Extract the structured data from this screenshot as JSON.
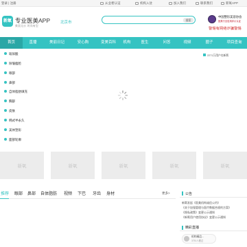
{
  "topbar": {
    "login": "登录 | 注册",
    "items": [
      "从业者认证",
      "机构入驻",
      "加入我们",
      "联系我们",
      "新氧APP"
    ]
  },
  "header": {
    "logo_badge": "新氧",
    "app_title": "专业医美APP",
    "app_subtitle": "美丽无价  时尚有型",
    "city": "北京市",
    "search_placeholder": "",
    "search_button": "搜索",
    "cert_line1": "中国整形美容协会",
    "cert_line2": "医美行业信用评价认证",
    "fraud_notice": "警惕有网络诈骗警惕"
  },
  "nav": {
    "items": [
      "首页",
      "直播",
      "美丽日记",
      "安心购",
      "变美百科",
      "机构",
      "医生",
      "问答",
      "视频",
      "圈子",
      "项目查询"
    ],
    "active_index": 0
  },
  "sidebar": {
    "items": [
      "玻尿酸",
      "除皱瘦脸",
      "眼部",
      "鼻部",
      "自体脂肪填充",
      "胸部",
      "皮肤",
      "韩式半永久",
      "美体塑形",
      "面部轮廓"
    ]
  },
  "right_panel": {
    "item": "2271万用户在新氧"
  },
  "tiles": {
    "label": "新氧"
  },
  "tabs": {
    "items": [
      "推荐",
      "眼部",
      "鼻部",
      "自体脂肪",
      "视频",
      "下巴",
      "牙齿",
      "身材"
    ],
    "more": "更多>"
  },
  "announcements": {
    "title": "公告",
    "lines": [
      "新氧发起《医美机构诚信公约》",
      "《关于加强管理与医疗数据合规的方案》",
      "《隐私政策》变更公示通知",
      "《新氧用户使用协议》变更公示通知"
    ]
  },
  "live": {
    "title": "精彩直播",
    "card_name": "机构精品...",
    "card_sub": "3751人看过"
  },
  "colors": {
    "accent": "#35c3c2",
    "warning": "#d23030"
  }
}
